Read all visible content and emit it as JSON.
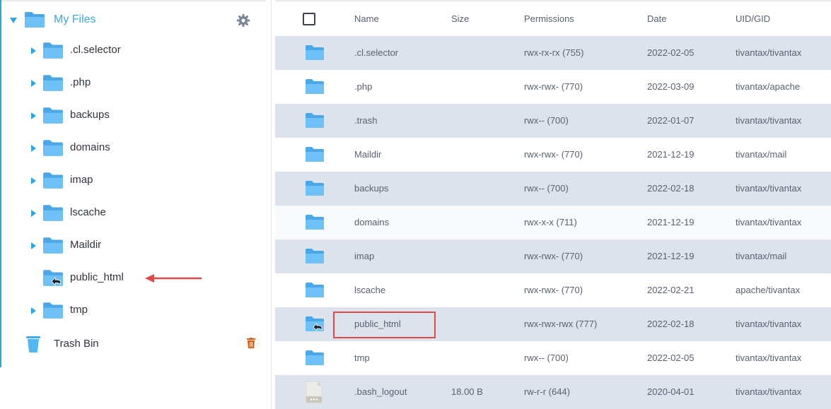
{
  "sidebar": {
    "root_label": "My Files",
    "items": [
      {
        "label": ".cl.selector",
        "expandable": true,
        "symlink": false
      },
      {
        "label": ".php",
        "expandable": true,
        "symlink": false
      },
      {
        "label": "backups",
        "expandable": true,
        "symlink": false
      },
      {
        "label": "domains",
        "expandable": true,
        "symlink": false
      },
      {
        "label": "imap",
        "expandable": true,
        "symlink": false
      },
      {
        "label": "lscache",
        "expandable": true,
        "symlink": false
      },
      {
        "label": "Maildir",
        "expandable": true,
        "symlink": false
      },
      {
        "label": "public_html",
        "expandable": false,
        "symlink": true
      },
      {
        "label": "tmp",
        "expandable": true,
        "symlink": false
      }
    ],
    "trash_label": "Trash Bin"
  },
  "table": {
    "headers": {
      "name": "Name",
      "size": "Size",
      "permissions": "Permissions",
      "date": "Date",
      "uid": "UID/GID"
    },
    "rows": [
      {
        "type": "folder",
        "name": ".cl.selector",
        "size": "",
        "permissions": "rwx-rx-rx (755)",
        "date": "2022-02-05",
        "uid": "tivantax/tivantax"
      },
      {
        "type": "folder",
        "name": ".php",
        "size": "",
        "permissions": "rwx-rwx- (770)",
        "date": "2022-03-09",
        "uid": "tivantax/apache"
      },
      {
        "type": "folder",
        "name": ".trash",
        "size": "",
        "permissions": "rwx-- (700)",
        "date": "2022-01-07",
        "uid": "tivantax/tivantax"
      },
      {
        "type": "folder",
        "name": "Maildir",
        "size": "",
        "permissions": "rwx-rwx- (770)",
        "date": "2021-12-19",
        "uid": "tivantax/mail"
      },
      {
        "type": "folder",
        "name": "backups",
        "size": "",
        "permissions": "rwx-- (700)",
        "date": "2022-02-18",
        "uid": "tivantax/tivantax"
      },
      {
        "type": "folder",
        "name": "domains",
        "size": "",
        "permissions": "rwx-x-x (711)",
        "date": "2021-12-19",
        "uid": "tivantax/tivantax"
      },
      {
        "type": "folder",
        "name": "imap",
        "size": "",
        "permissions": "rwx-rwx- (770)",
        "date": "2021-12-19",
        "uid": "tivantax/mail"
      },
      {
        "type": "folder",
        "name": "lscache",
        "size": "",
        "permissions": "rwx-rwx- (770)",
        "date": "2022-02-21",
        "uid": "apache/tivantax"
      },
      {
        "type": "symlink",
        "name": "public_html",
        "size": "",
        "permissions": "rwx-rwx-rwx (777)",
        "date": "2022-02-18",
        "uid": "tivantax/tivantax"
      },
      {
        "type": "folder",
        "name": "tmp",
        "size": "",
        "permissions": "rwx-- (700)",
        "date": "2022-02-05",
        "uid": "tivantax/tivantax"
      },
      {
        "type": "file",
        "name": ".bash_logout",
        "size": "18.00 B",
        "permissions": "rw-r-r (644)",
        "date": "2020-04-01",
        "uid": "tivantax/tivantax"
      }
    ]
  },
  "colors": {
    "accent": "#29a8df",
    "folder": "#5bb8f5",
    "row_shade": "#dde3ec",
    "highlight": "#e0484a",
    "trash_delete": "#e8590c"
  }
}
